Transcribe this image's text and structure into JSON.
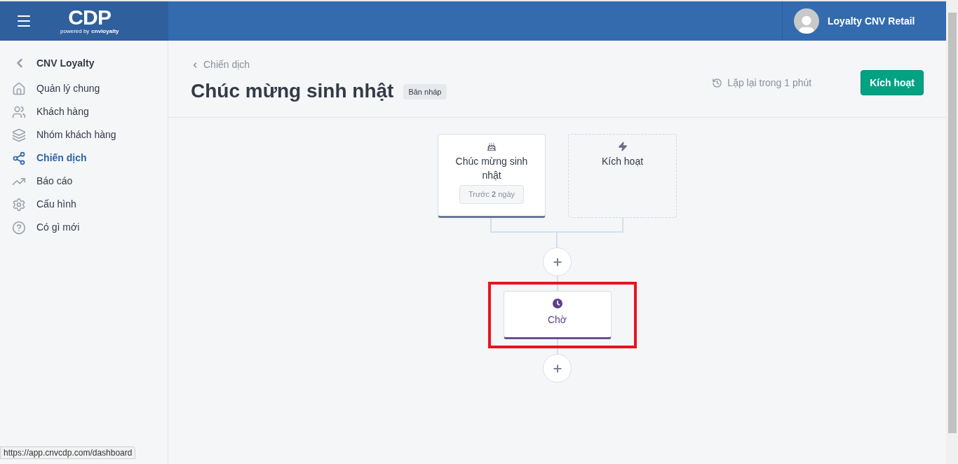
{
  "header": {
    "logo": "CDP",
    "logo_tagline": "powered by",
    "logo_brand": "cnvloyalty",
    "user_name": "Loyalty CNV Retail"
  },
  "sidebar": {
    "title": "CNV Loyalty",
    "items": [
      {
        "label": "Quản lý chung",
        "selected": false
      },
      {
        "label": "Khách hàng",
        "selected": false
      },
      {
        "label": "Nhóm khách hàng",
        "selected": false
      },
      {
        "label": "Chiến dịch",
        "selected": true
      },
      {
        "label": "Báo cáo",
        "selected": false
      },
      {
        "label": "Cấu hình",
        "selected": false
      },
      {
        "label": "Có gì mới",
        "selected": false
      }
    ]
  },
  "breadcrumb": "Chiến dịch",
  "title": "Chúc mừng sinh nhật",
  "status_badge": "Bản nháp",
  "autosave": "Lặp lại trong 1 phút",
  "activate_button": "Kích hoạt",
  "flow": {
    "triggers": [
      {
        "kind": "event",
        "title": "Chúc mừng sinh nhật",
        "condition": "Trước **2** ngày"
      },
      {
        "kind": "placeholder",
        "title": "Kích hoạt"
      }
    ],
    "steps": [
      {
        "kind": "add"
      },
      {
        "kind": "wait",
        "title": "Chờ",
        "highlighted": true
      },
      {
        "kind": "add"
      }
    ]
  },
  "status_url": "https://app.cnvcdp.com/dashboard"
}
